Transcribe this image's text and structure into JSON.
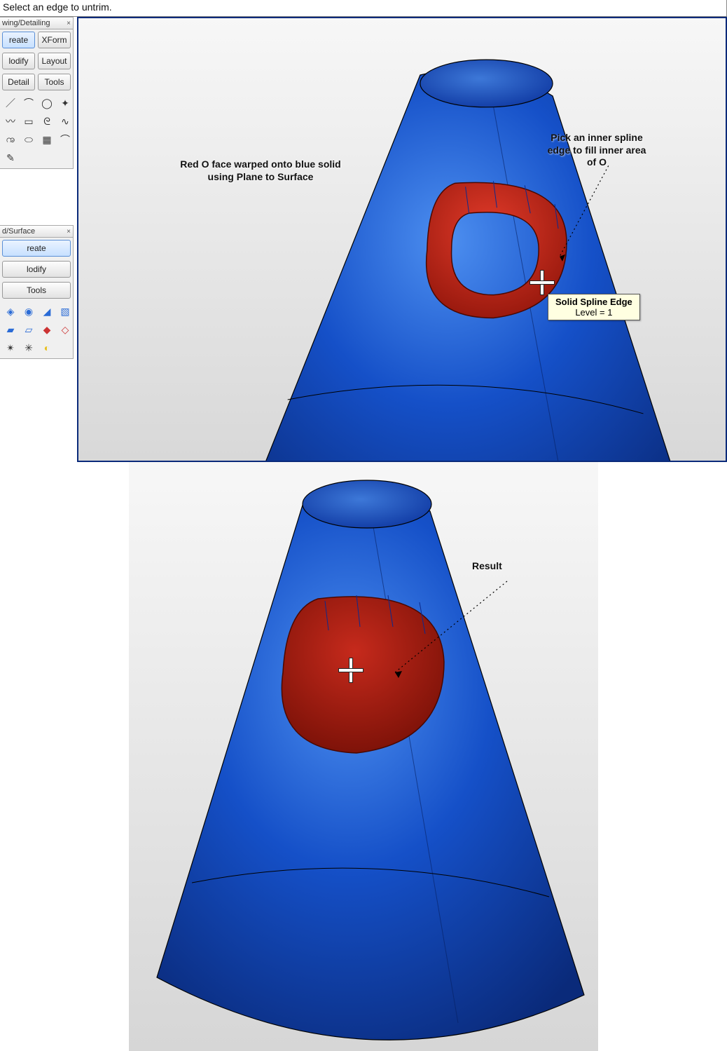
{
  "prompt_bar": "Select an edge to untrim.",
  "panels": {
    "drawing": {
      "title": "wing/Detailing",
      "buttons": [
        "reate",
        "XForm",
        "lodify",
        "Layout",
        "Detail",
        "Tools"
      ]
    },
    "solid": {
      "title": "d/Surface",
      "buttons": [
        "reate",
        "lodify",
        "Tools"
      ]
    }
  },
  "annotations": {
    "warp": "Red O face warped onto blue solid\nusing Plane to Surface",
    "pick": "Pick an inner spline\nedge to fill inner area\nof O",
    "result": "Result"
  },
  "tooltip": {
    "line1": "Solid Spline Edge",
    "line2": "Level = 1"
  }
}
